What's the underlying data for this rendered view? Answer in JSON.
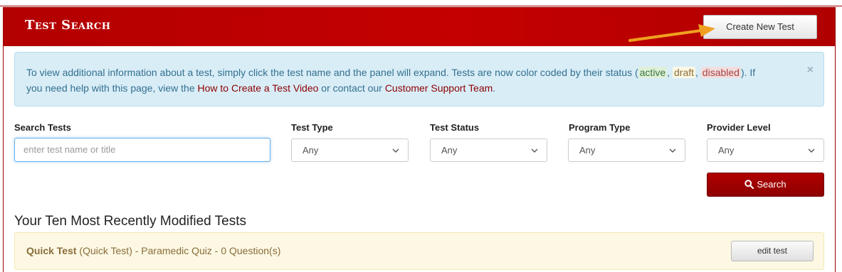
{
  "header": {
    "title": "Test Search",
    "create_button": "Create New Test"
  },
  "alert": {
    "text_1": "To view additional information about a test, simply click the test name and the panel will expand. Tests are now color coded by their status (",
    "status_active": "active",
    "sep_1": ", ",
    "status_draft": "draft",
    "sep_2": ", ",
    "status_disabled": "disabled",
    "text_2": "). If you need help with this page, view the ",
    "link_video": "How to Create a Test Video",
    "text_3": " or contact our ",
    "link_support": "Customer Support Team",
    "text_4": ".",
    "close": "×"
  },
  "filters": {
    "search_label": "Search Tests",
    "search_placeholder": "enter test name or title",
    "test_type": {
      "label": "Test Type",
      "value": "Any"
    },
    "test_status": {
      "label": "Test Status",
      "value": "Any"
    },
    "program_type": {
      "label": "Program Type",
      "value": "Any"
    },
    "provider_level": {
      "label": "Provider Level",
      "value": "Any"
    },
    "search_button": "Search"
  },
  "recent": {
    "heading": "Your Ten Most Recently Modified Tests",
    "tests": [
      {
        "name": "Quick Test",
        "details": " (Quick Test) - Paramedic Quiz - 0 Question(s)",
        "edit_label": "edit test",
        "status": "draft"
      }
    ]
  },
  "colors": {
    "brand_red": "#c40000",
    "alert_info_bg": "#d9edf7",
    "draft_bg": "#fcf8e3",
    "annotation_arrow": "#f0a020"
  },
  "icons": {
    "close": "close-icon",
    "search": "search-icon",
    "dropdown": "chevron-down-icon"
  }
}
